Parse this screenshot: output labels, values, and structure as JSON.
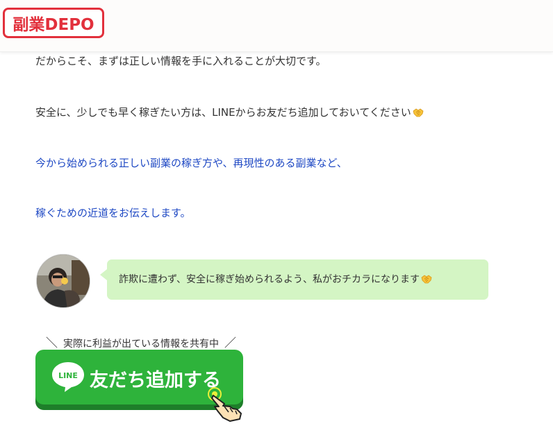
{
  "header": {
    "logo_text": "副業DEPO"
  },
  "article": {
    "paragraphs": [
      "だからこそ、まずは正しい情報を手に入れることが大切です。",
      "安全に、少しでも早く稼ぎたい方は、LINEからお友だち追加しておいてください",
      "今から始められる正しい副業の稼ぎ方や、再現性のある副業など、",
      "稼ぐための近道をお伝えします。"
    ],
    "link_color": "#1f49c4"
  },
  "speech": {
    "text": "詐欺に遭わず、安全に稼ぎ始められるよう、私がおチカラになります",
    "bubble_color": "#d4f5c4"
  },
  "cta": {
    "caption": "実際に利益が出ている情報を共有中",
    "caption_left": "＼",
    "caption_right": "／",
    "line_logo_text": "LINE",
    "button_label": "友だち追加する",
    "button_color": "#2eb33b"
  },
  "icons": {
    "paragraph_emoji": "handshake-icon",
    "speech_emoji": "handshake-icon",
    "cta_pointer": "pointing-hand-icon"
  },
  "brand_color": "#e2303c"
}
